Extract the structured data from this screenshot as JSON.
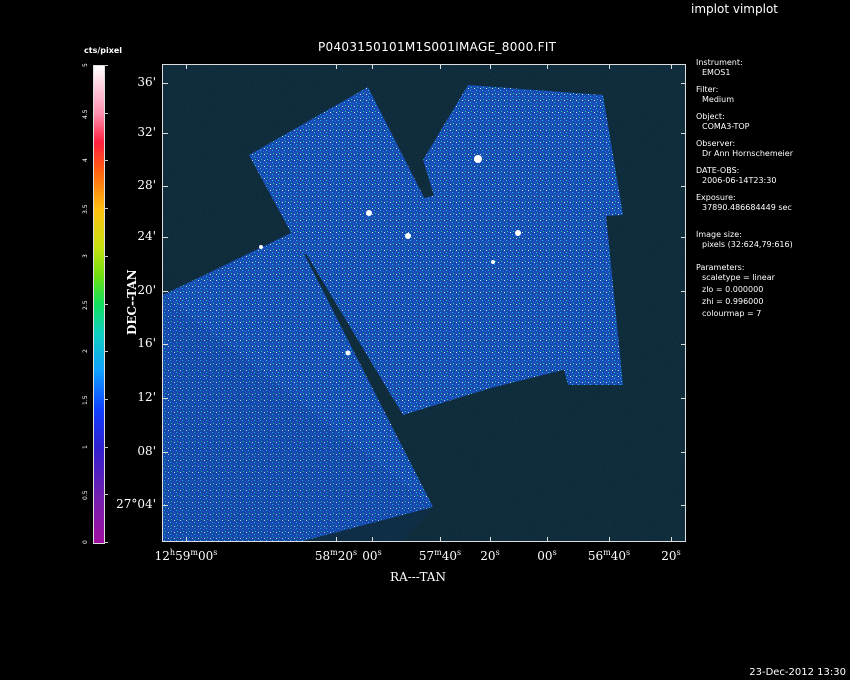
{
  "window": {
    "app_title": "implot vimplot",
    "timestamp": "23-Dec-2012 13:30"
  },
  "plot": {
    "title": "P0403150101M1S001IMAGE_8000.FIT",
    "xlabel": "RA---TAN",
    "ylabel": "DEC--TAN",
    "y_ticks": [
      "36'",
      "32'",
      "28'",
      "24'",
      "20'",
      "16'",
      "12'",
      "08'",
      "27°04'"
    ],
    "x_ticks": [
      {
        "h": "12",
        "m": "59",
        "s": "00"
      },
      {
        "m": "58",
        "s": "20"
      },
      {
        "s": "00"
      },
      {
        "m": "57",
        "s": "40"
      },
      {
        "s": "20"
      },
      {
        "s": "00"
      },
      {
        "m": "56",
        "s": "40"
      },
      {
        "s": "20"
      }
    ]
  },
  "colorbar": {
    "unit": "cts/pixel",
    "labels": [
      "5",
      "4.5",
      "4",
      "3.5",
      "3",
      "2.5",
      "2",
      "1.5",
      "1",
      "0.5",
      "0"
    ]
  },
  "info": {
    "instrument_label": "Instrument:",
    "instrument": "EMOS1",
    "filter_label": "Filter:",
    "filter": "Medium",
    "object_label": "Object:",
    "object": "COMA3-TOP",
    "observer_label": "Observer:",
    "observer": "Dr Ann Hornschemeier",
    "date_label": "DATE-OBS:",
    "date": "2006-06-14T23:30",
    "exposure_label": "Exposure:",
    "exposure": "37890.486684449 sec",
    "imagesize_label": "Image size:",
    "imagesize": "pixels (32:624,79:616)",
    "params_label": "Parameters:",
    "scaletype": "scaletype = linear",
    "zlo": "zlo = 0.000000",
    "zhi": "zhi = 0.996000",
    "colourmap": "colourmap =   7"
  }
}
